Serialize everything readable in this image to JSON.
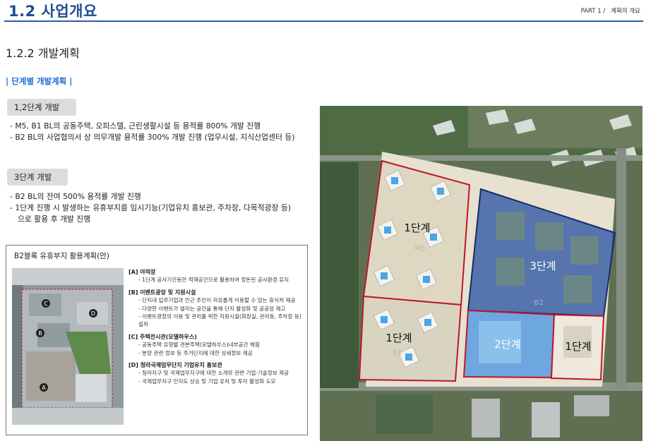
{
  "header": {
    "section_title": "1.2 사업개요",
    "part_label": "PART 1 /",
    "part_title": "계획의 개요"
  },
  "subsection": {
    "title": "1.2.2 개발계획"
  },
  "phase_plan": {
    "title": "| 단계별 개발계획 |"
  },
  "phase12": {
    "badge": "1,2단계 개발",
    "bullets": [
      "- M5, B1 BL의 공동주택, 오피스텔, 근린생활시설 등 용적률 800% 개발 진행",
      "- B2 BL의 사업협의서 상 의무개발 용적률 300% 개발 진행 (업무시설, 지식산업센터 등)"
    ]
  },
  "phase3": {
    "badge": "3단계 개발",
    "bullets": [
      "- B2 BL의 잔여 500% 용적률 개발 진행",
      "- 1단계 진행 시 발생하는 유휴부지를 임시기능(기업유치 홍보관, 주차장, 다목적광장 등)",
      "으로 활용 후 개발 진행"
    ]
  },
  "inset": {
    "title": "B2블록 유휴부지 활용계획(안)",
    "map_labels": [
      "A",
      "B",
      "C",
      "D"
    ],
    "legend": [
      {
        "head": "[A] 야적장",
        "items": [
          "- 1단계 공사기간동안 적재공간으로 활용하여 정돈된 공사환경 유지"
        ]
      },
      {
        "head": "[B] 이벤트광장 및 지원시설",
        "items": [
          "- 단지내 입주기업과 인근 주민이 자유롭게 이용할 수 있는 휴식처 제공",
          "- 다양한 이벤트가 열리는 공간을 통해 단지 활성화 및 공공성 제고",
          "- 이벤트광장의 이용 및 관리를 위한 지원시설(화장실, 관리동, 주차장 등) 설치"
        ]
      },
      {
        "head": "[C] 주택전시관(모델하우스)",
        "items": [
          "- 공동주택 유형별 견본주택(모델하우스)내부공간 체험",
          "- 분양 관련 정보 등 주거단지에 대한 상세정보 제공"
        ]
      },
      {
        "head": "[D] 청라국제업무단지 기업유치 홍보관",
        "items": [
          "- 청라지구 및 국제업무지구에 대한 소개와 관련 기업·기술정보 제공",
          "- 국제업무지구 인지도 상승 및 기업 유치 및 투자 활성화 도모"
        ]
      }
    ]
  },
  "main_map": {
    "labels": {
      "phase1_top": "1단계",
      "phase1_bottom": "1단계",
      "phase3": "3단계",
      "phase2": "2단계",
      "phase1_right": "1단계",
      "block_m5": "M5",
      "block_b1": "B1",
      "block_b2": "B2"
    },
    "colors": {
      "outline": "#c0162a",
      "phase3_fill": "#1e4aa0",
      "phase2_fill": "#3a8ee6"
    }
  }
}
